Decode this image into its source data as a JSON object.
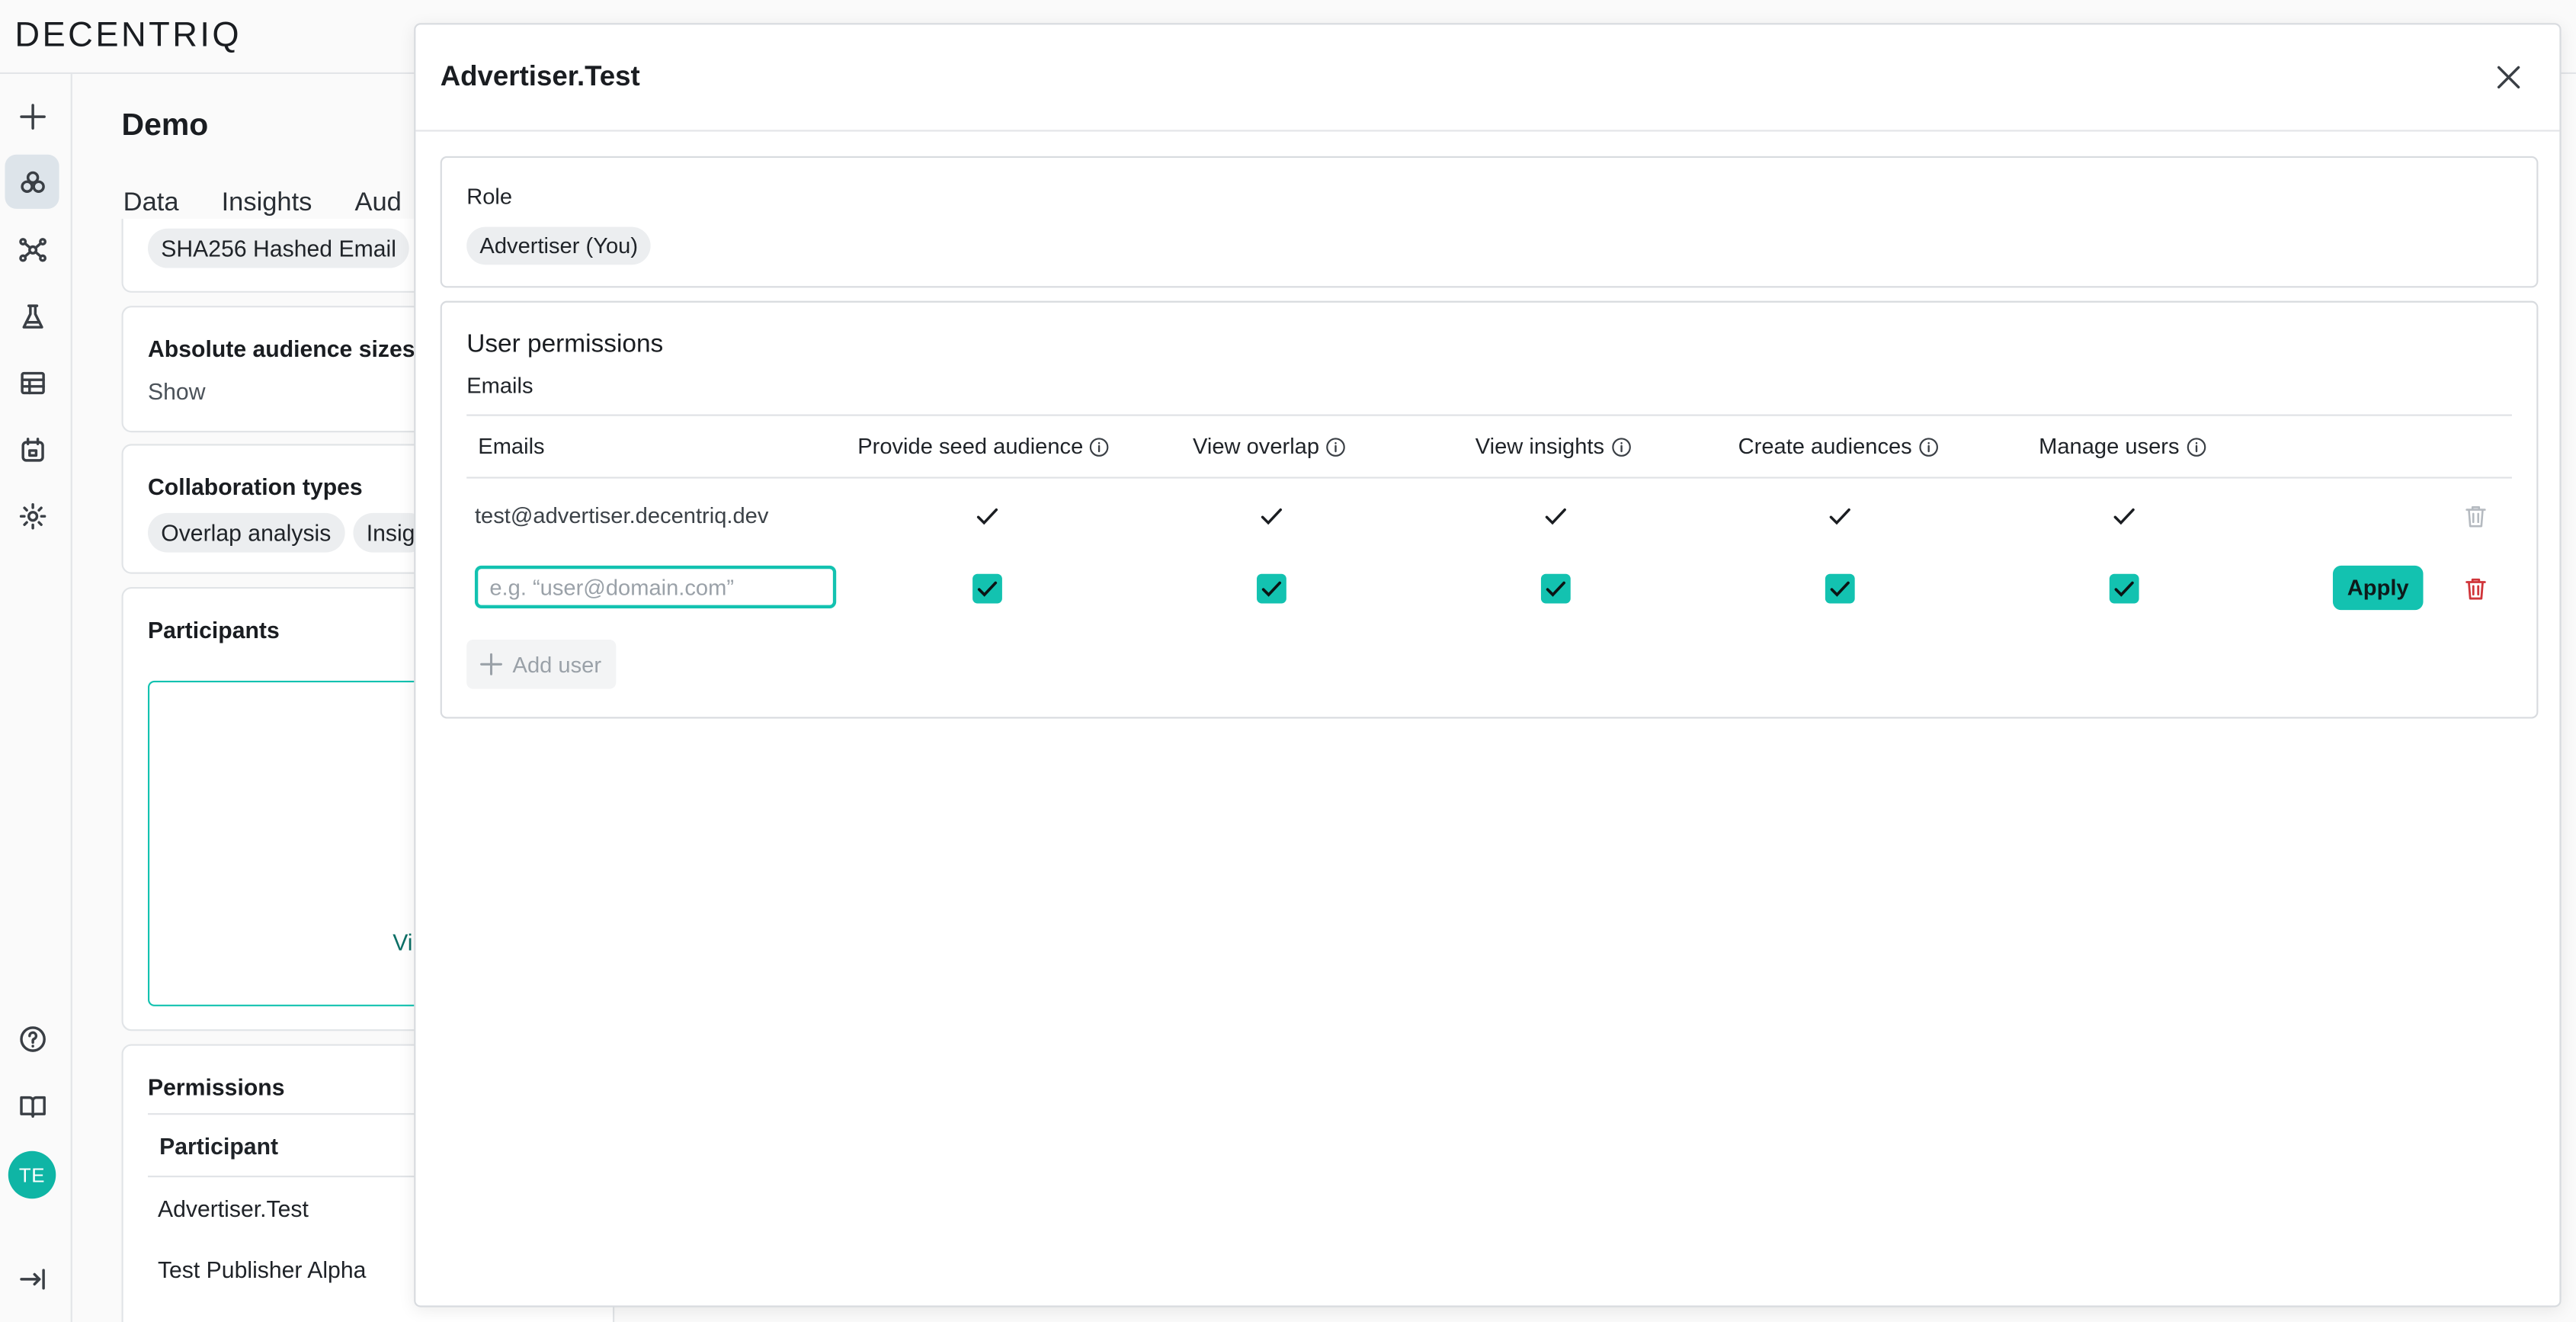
{
  "app": {
    "logo": "DECENTRIQ"
  },
  "rail": {
    "items": [
      {
        "icon": "plus-icon"
      },
      {
        "icon": "collaboration-icon",
        "active": true
      },
      {
        "icon": "network-icon"
      },
      {
        "icon": "flask-icon"
      },
      {
        "icon": "table-icon"
      },
      {
        "icon": "datalab-icon"
      },
      {
        "icon": "settings-icon"
      }
    ],
    "bottom": [
      {
        "icon": "help-icon"
      },
      {
        "icon": "book-icon"
      },
      {
        "icon": "logout-icon"
      }
    ],
    "avatar": "TE"
  },
  "page": {
    "title": "Demo",
    "tabs": [
      "Data",
      "Insights",
      "Aud"
    ],
    "matching_chip": "SHA256 Hashed Email",
    "absolute_sizes": {
      "label": "Absolute audience sizes",
      "value": "Show"
    },
    "collab_types": {
      "label": "Collaboration types",
      "chips": [
        "Overlap analysis",
        "Insig"
      ]
    },
    "participants": {
      "label": "Participants",
      "fragment": "Vi"
    },
    "permissions": {
      "label": "Permissions",
      "header": "Participant",
      "rows": [
        "Advertiser.Test",
        "Test Publisher Alpha"
      ]
    }
  },
  "modal": {
    "title": "Advertiser.Test",
    "role": {
      "label": "Role",
      "value": "Advertiser (You)"
    },
    "user_permissions": {
      "title": "User permissions",
      "subtitle": "Emails",
      "columns": [
        "Emails",
        "Provide seed audience",
        "View overlap",
        "View insights",
        "Create audiences",
        "Manage users"
      ],
      "rows": [
        {
          "email": "test@advertiser.decentriq.dev",
          "perms": [
            true,
            true,
            true,
            true,
            true
          ]
        }
      ],
      "new_row": {
        "placeholder": "e.g. “user@domain.com”",
        "perms": [
          true,
          true,
          true,
          true,
          true
        ],
        "apply_label": "Apply"
      },
      "add_user_label": "Add user"
    },
    "colors": {
      "accent": "#13c2b0",
      "danger": "#d0353a"
    }
  }
}
